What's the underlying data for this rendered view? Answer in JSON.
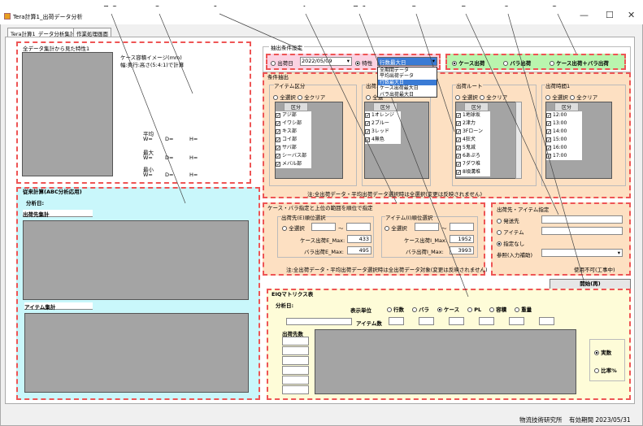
{
  "window": {
    "title": "Tera計算1_出荷データ分析",
    "min": "—",
    "max": "☐",
    "close": "✕"
  },
  "tabs": [
    "Tera計算1_データ分析集計",
    "作業処理画面"
  ],
  "callouts": [
    "7-2",
    "8",
    "1",
    "4",
    "7-1",
    "3",
    "5",
    "6",
    "2"
  ],
  "overall": {
    "title": "全データ集計から見た特性1",
    "case_image_title": "ケース容積イメージ(mm)",
    "case_image_sub": "幅:奥行:高さ(5:4:1)で計算",
    "avg": "平均",
    "max": "最大",
    "min": "最小",
    "w": "W=",
    "d": "D=",
    "h": "H="
  },
  "abc": {
    "title": "従来計算(ABC分析応用)",
    "date": "分析日:",
    "dest": "出荷先集計",
    "item": "アイテム集計"
  },
  "extract_title": "抽出条件設定",
  "ship_date": {
    "label": "出荷日",
    "value": "2022/05/09"
  },
  "feature": {
    "label": "特性",
    "value": "行数最大日",
    "options": [
      "全期間データ",
      "平均出荷データ",
      "行数最大日",
      "ケース出荷最大日",
      "バラ出荷最大日"
    ],
    "selected_index": 2
  },
  "unit_choice": [
    "ケース出荷",
    "バラ出荷",
    "ケース出荷＋バラ出荷"
  ],
  "cond": {
    "title": "条件抽出",
    "note": "注:全出荷データ・平均出荷データ選択時は全選択(変更は反映されません)"
  },
  "item_class": {
    "title": "アイテム区分",
    "all": "全選択",
    "clear": "全クリア",
    "header": "区分",
    "items": [
      "アジ部",
      "イワシ部",
      "キス部",
      "コイ部",
      "サバ部",
      "シーバス部",
      "メバル部"
    ]
  },
  "ship_pattern": {
    "title": "出荷...",
    "all": "全選",
    "header": "区分",
    "items": [
      "1オレンジ",
      "2ブルー",
      "3レッド",
      "4無色"
    ]
  },
  "route": {
    "title": "出荷ルート",
    "all": "全選択",
    "clear": "全クリア",
    "header": "区分",
    "items": [
      "1地球坂",
      "2津力",
      "3Fローン",
      "4狂犬",
      "5鬼滅",
      "6あぷろ",
      "7ダワ堆",
      "8頃溝堆"
    ]
  },
  "time": {
    "title": "出荷時間1",
    "all": "全選択",
    "clear": "全クリア",
    "header": "区分",
    "items": [
      "12:00",
      "13:00",
      "14:00",
      "15:00",
      "16:00",
      "17:00"
    ]
  },
  "rank": {
    "title": "ケース・バラ指定と上位の範囲を順位で指定",
    "dest_title": "出荷先(E)順位選択",
    "item_title": "アイテム(I)順位選択",
    "all": "全選択",
    "tilde": "～",
    "dest_case": "ケース出荷E_Max:",
    "dest_case_v": "433",
    "dest_bara": "バラ出荷E_Max:",
    "dest_bara_v": "495",
    "item_case": "ケース出荷I_Max:",
    "item_case_v": "1952",
    "item_bara": "バラ出荷I_Max:",
    "item_bara_v": "3993",
    "note": "注:全出荷データ・平均出荷データ選択時は全出荷データ対象(変更は反映されません)"
  },
  "dest_item": {
    "title": "出荷先・アイテム指定",
    "opts": [
      "発送先",
      "アイテム",
      "指定なし"
    ],
    "ref": "参照(入力補助)",
    "unusable": "使用不可(工事中)"
  },
  "start": "開始(再)",
  "eiq": {
    "title": "EIQマトリクス表",
    "date": "分析日:",
    "unit": "表示単位",
    "units": [
      "行数",
      "バラ",
      "ケース",
      "PL",
      "容積",
      "重量"
    ],
    "item_count": "アイテム数",
    "dest_count": "出荷先数",
    "actual": "実数",
    "ratio": "比率%"
  },
  "footer": {
    "org": "物流技術研究所",
    "validity": "有効期間 2023/05/31"
  },
  "colors": {
    "red": "#e55555",
    "cyan": "#c9f7fb",
    "orange": "#fde0c2",
    "yellow": "#fefcd8",
    "green": "#b9f5ae",
    "pink": "#fbd2e2",
    "gray": "#a4a4a4"
  }
}
